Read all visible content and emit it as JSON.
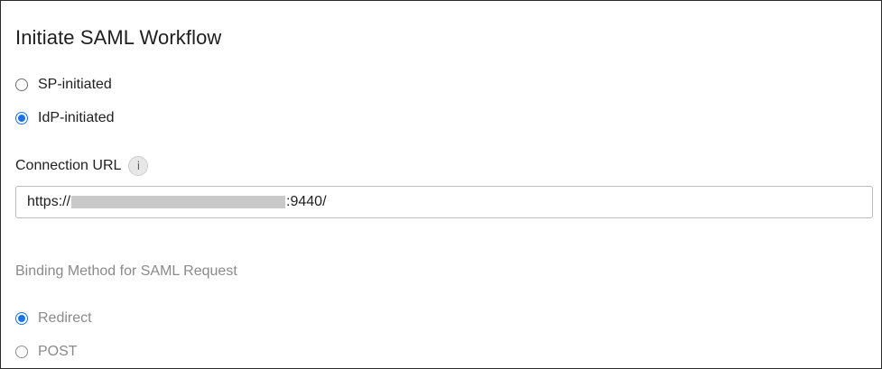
{
  "title": "Initiate SAML Workflow",
  "workflow_options": [
    {
      "label": "SP-initiated",
      "checked": false
    },
    {
      "label": "IdP-initiated",
      "checked": true
    }
  ],
  "connection_url": {
    "label": "Connection URL",
    "info_glyph": "i",
    "value_prefix": "https://",
    "value_suffix": ":9440/"
  },
  "binding": {
    "heading": "Binding Method for SAML Request",
    "options": [
      {
        "label": "Redirect",
        "checked": true
      },
      {
        "label": "POST",
        "checked": false
      }
    ]
  },
  "colors": {
    "accent": "#1a73e8",
    "muted_text": "#8a8a8a",
    "redaction": "#c9c9c9"
  }
}
